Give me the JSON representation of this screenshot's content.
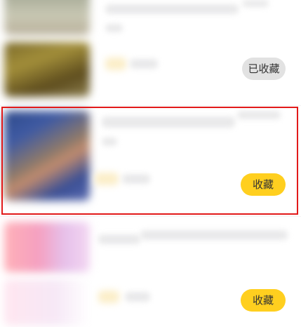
{
  "items": [
    {
      "action_label": ""
    },
    {
      "action_label": "已收藏"
    },
    {
      "action_label": "收藏"
    },
    {
      "action_label": ""
    },
    {
      "action_label": "收藏"
    }
  ]
}
